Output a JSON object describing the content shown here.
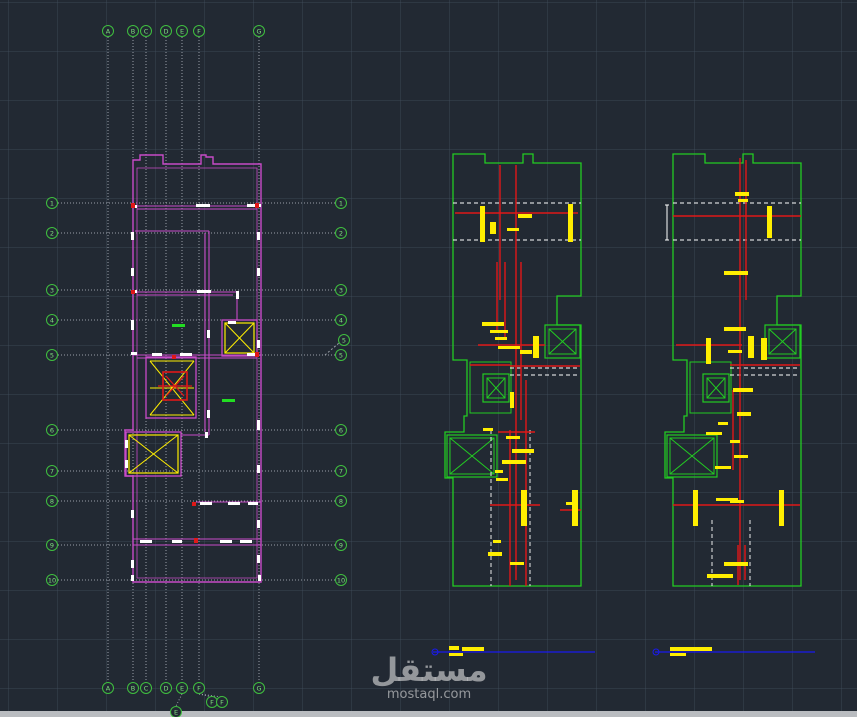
{
  "grid": {
    "columns_top": [
      "A",
      "B",
      "C",
      "D",
      "E",
      "F",
      "G"
    ],
    "columns_bottom": [
      "A",
      "B",
      "C",
      "D",
      "E",
      "F",
      "G"
    ],
    "columns_extra": [
      "E",
      "F",
      "F"
    ],
    "rows_left": [
      "1",
      "2",
      "3",
      "4",
      "5",
      "6",
      "7",
      "8",
      "9",
      "10"
    ],
    "rows_right": [
      "1",
      "2",
      "3",
      "4",
      "5",
      "6",
      "7",
      "8",
      "9",
      "10"
    ]
  },
  "section_marker": {
    "label": "5"
  },
  "watermark": {
    "logo_text": "مستقل",
    "site": "mostaql.com"
  },
  "colors": {
    "background": "#222933",
    "grid_line": "#9aa0a8",
    "bubble": "#3fbf3f",
    "bubble_text": "#7fe07f",
    "architecture": "#c84bc8",
    "structure": "#22cc22",
    "beam_dash": "#ffffff",
    "rebar": "#e01818",
    "column_mark": "#ffee00",
    "section_line": "#1a1aee",
    "scrollbar": "#b9bcc0"
  }
}
